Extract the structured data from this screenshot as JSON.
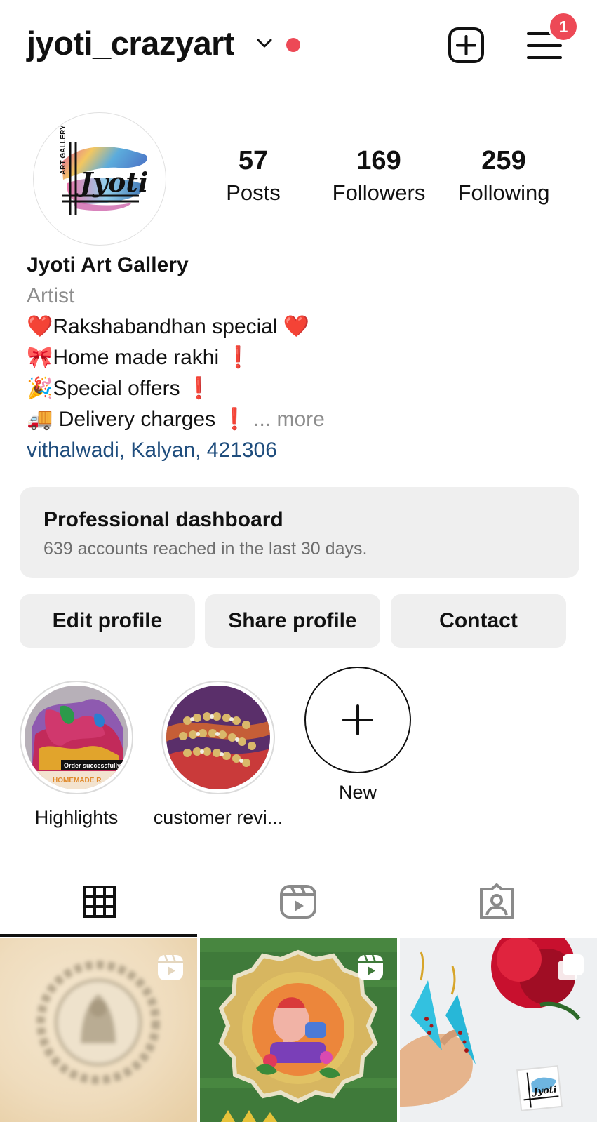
{
  "header": {
    "username": "jyoti_crazyart",
    "notification_count": "1",
    "accent_color": "#ed4956"
  },
  "profile": {
    "avatar_logo_text": "Jyoti",
    "avatar_logo_side": "ART GALLERY",
    "stats": [
      {
        "value": "57",
        "label": "Posts"
      },
      {
        "value": "169",
        "label": "Followers"
      },
      {
        "value": "259",
        "label": "Following"
      }
    ],
    "display_name": "Jyoti Art Gallery",
    "category": "Artist",
    "bio_lines": [
      "❤️Rakshabandhan special ❤️",
      "🎀Home made rakhi ❗",
      "🎉Special offers ❗",
      "🚚 Delivery charges ❗"
    ],
    "more_label": "... more",
    "location": "vithalwadi, Kalyan, 421306",
    "location_color": "#1f4d7d"
  },
  "dashboard": {
    "title": "Professional dashboard",
    "subtitle": "639 accounts reached in the last 30 days."
  },
  "buttons": {
    "edit": "Edit profile",
    "share": "Share profile",
    "contact": "Contact"
  },
  "highlights": [
    {
      "label": "Highlights",
      "overlay_text": "Order successfully",
      "overlay_text2": "HOMEMADE R"
    },
    {
      "label": "customer revi..."
    },
    {
      "label": "New"
    }
  ],
  "tabs": [
    {
      "name": "grid",
      "icon": "grid-icon",
      "active": true
    },
    {
      "name": "reels",
      "icon": "reels-icon",
      "active": false
    },
    {
      "name": "tagged",
      "icon": "tagged-icon",
      "active": false
    }
  ],
  "posts": [
    {
      "type": "reel",
      "icon": "reels-icon"
    },
    {
      "type": "reel",
      "icon": "reels-icon"
    },
    {
      "type": "carousel",
      "icon": "carousel-icon",
      "logo_text": "Jyoti"
    }
  ]
}
